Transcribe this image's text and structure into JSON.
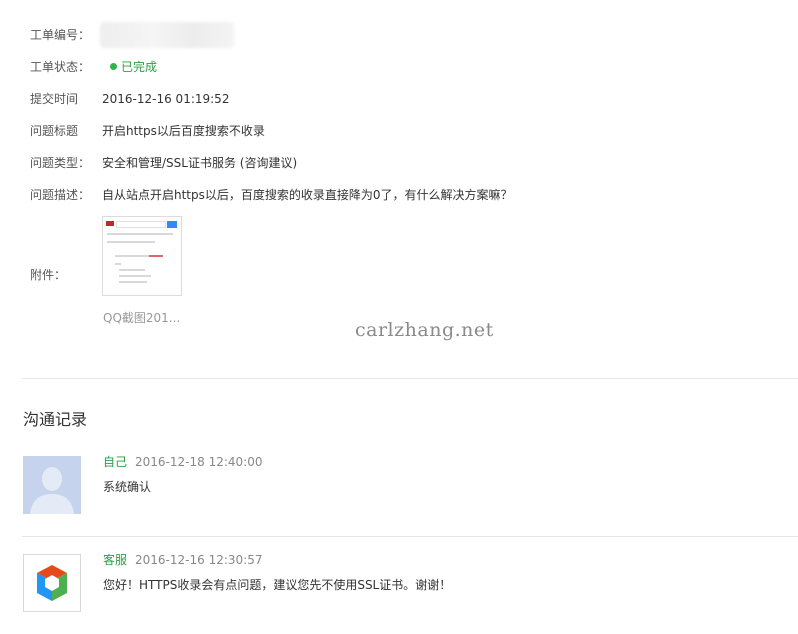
{
  "ticket": {
    "fields": {
      "id_label": "工单编号：",
      "status_label": "工单状态：",
      "status_value": "已完成",
      "submit_time_label": "提交时间",
      "submit_time_value": "2016-12-16 01:19:52",
      "title_label": "问题标题",
      "title_value": "开启https以后百度搜索不收录",
      "type_label": "问题类型：",
      "type_value": "安全和管理/SSL证书服务 (咨询建议)",
      "desc_label": "问题描述：",
      "desc_value": "自从站点开启https以后，百度搜索的收录直接降为0了，有什么解决方案嘛？",
      "attachment_label": "附件："
    },
    "attachment": {
      "caption": "QQ截图201..."
    }
  },
  "watermark": "carlzhang.net",
  "communication": {
    "title": "沟通记录",
    "records": [
      {
        "author": "自己",
        "time": "2016-12-18 12:40:00",
        "message": "系统确认",
        "avatar_icon": "default-user-avatar-icon"
      },
      {
        "author": "客服",
        "time": "2016-12-16 12:30:57",
        "message": "您好！HTTPS收录会有点问题，建议您先不使用SSL证书。谢谢！",
        "avatar_icon": "service-logo-icon"
      }
    ]
  },
  "colors": {
    "status_green": "#2fb34c",
    "author_green": "#2e9d45",
    "avatar_blue": "#c5d3ec"
  }
}
